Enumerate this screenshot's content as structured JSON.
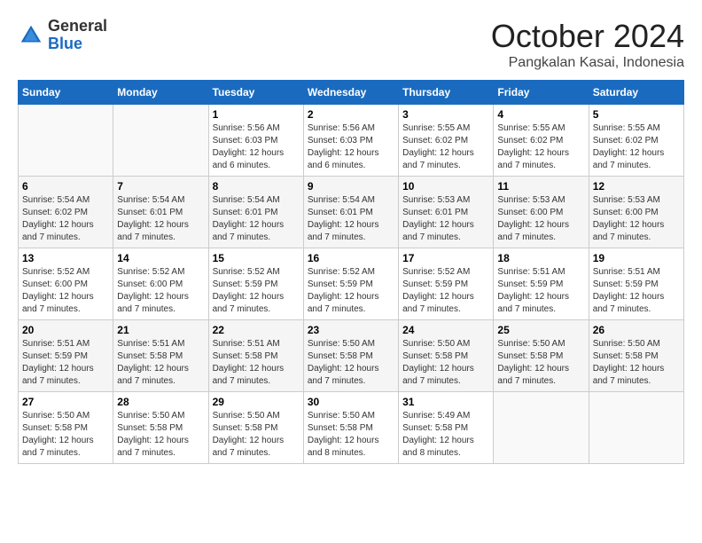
{
  "header": {
    "logo_general": "General",
    "logo_blue": "Blue",
    "month": "October 2024",
    "location": "Pangkalan Kasai, Indonesia"
  },
  "days_of_week": [
    "Sunday",
    "Monday",
    "Tuesday",
    "Wednesday",
    "Thursday",
    "Friday",
    "Saturday"
  ],
  "weeks": [
    [
      {
        "day": "",
        "sunrise": "",
        "sunset": "",
        "daylight": ""
      },
      {
        "day": "",
        "sunrise": "",
        "sunset": "",
        "daylight": ""
      },
      {
        "day": "1",
        "sunrise": "Sunrise: 5:56 AM",
        "sunset": "Sunset: 6:03 PM",
        "daylight": "Daylight: 12 hours and 6 minutes."
      },
      {
        "day": "2",
        "sunrise": "Sunrise: 5:56 AM",
        "sunset": "Sunset: 6:03 PM",
        "daylight": "Daylight: 12 hours and 6 minutes."
      },
      {
        "day": "3",
        "sunrise": "Sunrise: 5:55 AM",
        "sunset": "Sunset: 6:02 PM",
        "daylight": "Daylight: 12 hours and 7 minutes."
      },
      {
        "day": "4",
        "sunrise": "Sunrise: 5:55 AM",
        "sunset": "Sunset: 6:02 PM",
        "daylight": "Daylight: 12 hours and 7 minutes."
      },
      {
        "day": "5",
        "sunrise": "Sunrise: 5:55 AM",
        "sunset": "Sunset: 6:02 PM",
        "daylight": "Daylight: 12 hours and 7 minutes."
      }
    ],
    [
      {
        "day": "6",
        "sunrise": "Sunrise: 5:54 AM",
        "sunset": "Sunset: 6:02 PM",
        "daylight": "Daylight: 12 hours and 7 minutes."
      },
      {
        "day": "7",
        "sunrise": "Sunrise: 5:54 AM",
        "sunset": "Sunset: 6:01 PM",
        "daylight": "Daylight: 12 hours and 7 minutes."
      },
      {
        "day": "8",
        "sunrise": "Sunrise: 5:54 AM",
        "sunset": "Sunset: 6:01 PM",
        "daylight": "Daylight: 12 hours and 7 minutes."
      },
      {
        "day": "9",
        "sunrise": "Sunrise: 5:54 AM",
        "sunset": "Sunset: 6:01 PM",
        "daylight": "Daylight: 12 hours and 7 minutes."
      },
      {
        "day": "10",
        "sunrise": "Sunrise: 5:53 AM",
        "sunset": "Sunset: 6:01 PM",
        "daylight": "Daylight: 12 hours and 7 minutes."
      },
      {
        "day": "11",
        "sunrise": "Sunrise: 5:53 AM",
        "sunset": "Sunset: 6:00 PM",
        "daylight": "Daylight: 12 hours and 7 minutes."
      },
      {
        "day": "12",
        "sunrise": "Sunrise: 5:53 AM",
        "sunset": "Sunset: 6:00 PM",
        "daylight": "Daylight: 12 hours and 7 minutes."
      }
    ],
    [
      {
        "day": "13",
        "sunrise": "Sunrise: 5:52 AM",
        "sunset": "Sunset: 6:00 PM",
        "daylight": "Daylight: 12 hours and 7 minutes."
      },
      {
        "day": "14",
        "sunrise": "Sunrise: 5:52 AM",
        "sunset": "Sunset: 6:00 PM",
        "daylight": "Daylight: 12 hours and 7 minutes."
      },
      {
        "day": "15",
        "sunrise": "Sunrise: 5:52 AM",
        "sunset": "Sunset: 5:59 PM",
        "daylight": "Daylight: 12 hours and 7 minutes."
      },
      {
        "day": "16",
        "sunrise": "Sunrise: 5:52 AM",
        "sunset": "Sunset: 5:59 PM",
        "daylight": "Daylight: 12 hours and 7 minutes."
      },
      {
        "day": "17",
        "sunrise": "Sunrise: 5:52 AM",
        "sunset": "Sunset: 5:59 PM",
        "daylight": "Daylight: 12 hours and 7 minutes."
      },
      {
        "day": "18",
        "sunrise": "Sunrise: 5:51 AM",
        "sunset": "Sunset: 5:59 PM",
        "daylight": "Daylight: 12 hours and 7 minutes."
      },
      {
        "day": "19",
        "sunrise": "Sunrise: 5:51 AM",
        "sunset": "Sunset: 5:59 PM",
        "daylight": "Daylight: 12 hours and 7 minutes."
      }
    ],
    [
      {
        "day": "20",
        "sunrise": "Sunrise: 5:51 AM",
        "sunset": "Sunset: 5:59 PM",
        "daylight": "Daylight: 12 hours and 7 minutes."
      },
      {
        "day": "21",
        "sunrise": "Sunrise: 5:51 AM",
        "sunset": "Sunset: 5:58 PM",
        "daylight": "Daylight: 12 hours and 7 minutes."
      },
      {
        "day": "22",
        "sunrise": "Sunrise: 5:51 AM",
        "sunset": "Sunset: 5:58 PM",
        "daylight": "Daylight: 12 hours and 7 minutes."
      },
      {
        "day": "23",
        "sunrise": "Sunrise: 5:50 AM",
        "sunset": "Sunset: 5:58 PM",
        "daylight": "Daylight: 12 hours and 7 minutes."
      },
      {
        "day": "24",
        "sunrise": "Sunrise: 5:50 AM",
        "sunset": "Sunset: 5:58 PM",
        "daylight": "Daylight: 12 hours and 7 minutes."
      },
      {
        "day": "25",
        "sunrise": "Sunrise: 5:50 AM",
        "sunset": "Sunset: 5:58 PM",
        "daylight": "Daylight: 12 hours and 7 minutes."
      },
      {
        "day": "26",
        "sunrise": "Sunrise: 5:50 AM",
        "sunset": "Sunset: 5:58 PM",
        "daylight": "Daylight: 12 hours and 7 minutes."
      }
    ],
    [
      {
        "day": "27",
        "sunrise": "Sunrise: 5:50 AM",
        "sunset": "Sunset: 5:58 PM",
        "daylight": "Daylight: 12 hours and 7 minutes."
      },
      {
        "day": "28",
        "sunrise": "Sunrise: 5:50 AM",
        "sunset": "Sunset: 5:58 PM",
        "daylight": "Daylight: 12 hours and 7 minutes."
      },
      {
        "day": "29",
        "sunrise": "Sunrise: 5:50 AM",
        "sunset": "Sunset: 5:58 PM",
        "daylight": "Daylight: 12 hours and 7 minutes."
      },
      {
        "day": "30",
        "sunrise": "Sunrise: 5:50 AM",
        "sunset": "Sunset: 5:58 PM",
        "daylight": "Daylight: 12 hours and 8 minutes."
      },
      {
        "day": "31",
        "sunrise": "Sunrise: 5:49 AM",
        "sunset": "Sunset: 5:58 PM",
        "daylight": "Daylight: 12 hours and 8 minutes."
      },
      {
        "day": "",
        "sunrise": "",
        "sunset": "",
        "daylight": ""
      },
      {
        "day": "",
        "sunrise": "",
        "sunset": "",
        "daylight": ""
      }
    ]
  ]
}
